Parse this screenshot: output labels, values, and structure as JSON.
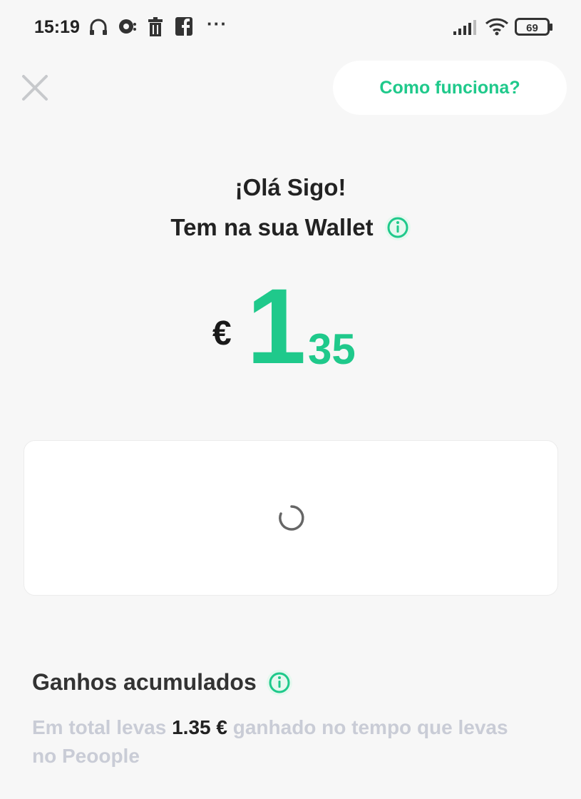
{
  "status_bar": {
    "time": "15:19",
    "left_icons": [
      "headphones-icon",
      "chat-bubble-icon",
      "trash-icon",
      "facebook-icon"
    ],
    "more": "···",
    "battery": "69"
  },
  "header": {
    "close_icon": "close-icon",
    "how_it_works_label": "Como funciona?"
  },
  "greeting": {
    "hello": "¡Olá Sigo!",
    "wallet_label": "Tem na sua Wallet"
  },
  "balance": {
    "currency": "€",
    "integer": "1",
    "decimal": "35"
  },
  "card": {
    "state": "loading"
  },
  "accumulated": {
    "title": "Ganhos acumulados",
    "text_before": "Em total levas",
    "amount": "1.35 €",
    "text_after": "ganhado no tempo que levas no Peoople"
  },
  "colors": {
    "accent": "#1fc98b",
    "background": "#f7f7f7",
    "muted_text": "#c9ccd6"
  }
}
